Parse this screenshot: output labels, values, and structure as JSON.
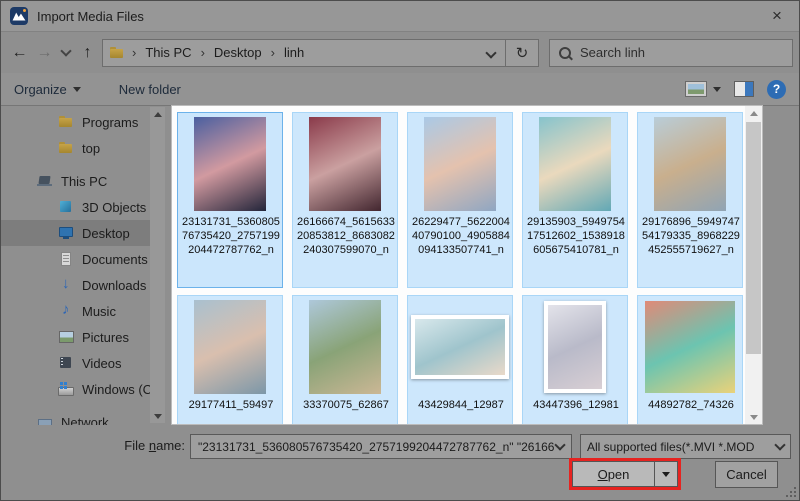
{
  "window": {
    "title": "Import Media Files"
  },
  "icons": {
    "close": "×",
    "back": "←",
    "forward": "→",
    "up": "↑",
    "refresh": "↻",
    "crumb_separator": "›",
    "help": "?"
  },
  "navbar": {
    "breadcrumb": {
      "segments": [
        "This PC",
        "Desktop",
        "linh"
      ]
    },
    "search": {
      "placeholder": "Search linh"
    }
  },
  "toolbar": {
    "organize_label": "Organize",
    "new_folder_label": "New folder"
  },
  "sidebar": {
    "items": [
      {
        "label": "Programs",
        "icon": "folder",
        "indent": 2
      },
      {
        "label": "top",
        "icon": "folder",
        "indent": 2
      },
      {
        "label": "This PC",
        "icon": "computer",
        "indent": 1,
        "group": true
      },
      {
        "label": "3D Objects",
        "icon": "cube",
        "indent": 2
      },
      {
        "label": "Desktop",
        "icon": "monitor",
        "indent": 2,
        "selected": true
      },
      {
        "label": "Documents",
        "icon": "document",
        "indent": 2
      },
      {
        "label": "Downloads",
        "icon": "download",
        "indent": 2
      },
      {
        "label": "Music",
        "icon": "music",
        "indent": 2
      },
      {
        "label": "Pictures",
        "icon": "picture",
        "indent": 2
      },
      {
        "label": "Videos",
        "icon": "film",
        "indent": 2
      },
      {
        "label": "Windows (C:)",
        "icon": "drive",
        "indent": 2
      },
      {
        "label": "Network",
        "icon": "network",
        "indent": 1,
        "group": true
      }
    ]
  },
  "files": [
    {
      "name": "23131731_536080576735420_2757199204472787762_n",
      "desc": "selfie of woman at night club with pink and blue lights",
      "orientation": "portrait",
      "framed": false,
      "focused": true,
      "colors": [
        "#4a5fa0",
        "#d29aa0",
        "#23253a"
      ]
    },
    {
      "name": "26166674_561563320853812_8683082240307599070_n",
      "desc": "woman in gray beanie beside dark red flowers",
      "orientation": "portrait",
      "framed": false,
      "focused": false,
      "colors": [
        "#8a3a4a",
        "#caa0a0",
        "#42262f"
      ]
    },
    {
      "name": "26229477_562200440790100_4905884094133507741_n",
      "desc": "woman in knit beanie against light sky",
      "orientation": "portrait",
      "framed": false,
      "focused": false,
      "colors": [
        "#aac9e6",
        "#e4c2ae",
        "#8fa6c2"
      ]
    },
    {
      "name": "29135903_594975417512602_1538918605675410781_n",
      "desc": "beach scene with round basket boat",
      "orientation": "portrait",
      "framed": false,
      "focused": false,
      "colors": [
        "#86c3cc",
        "#ead9bd",
        "#62a8b5"
      ]
    },
    {
      "name": "29176896_594974754179335_8968229452555719627_n",
      "desc": "woman standing near tan rocks under cloudy sky",
      "orientation": "portrait",
      "framed": false,
      "focused": false,
      "colors": [
        "#b9cdd8",
        "#c9af8d",
        "#90a4b4"
      ]
    },
    {
      "name": "29177411_59497",
      "desc": "woman covering one eye with her hand",
      "orientation": "portrait",
      "framed": false,
      "focused": false,
      "colors": [
        "#a9c0cf",
        "#d9bfae",
        "#7c97a8"
      ]
    },
    {
      "name": "33370075_62867",
      "desc": "woman sitting on rocks with arm raised",
      "orientation": "portrait",
      "framed": false,
      "focused": false,
      "colors": [
        "#aec8da",
        "#89a377",
        "#cbb795"
      ]
    },
    {
      "name": "43429844_12987",
      "desc": "bright seaside photo of woman sitting on wall",
      "orientation": "landscape",
      "framed": true,
      "focused": false,
      "colors": [
        "#d8e8ec",
        "#9fc4cc",
        "#e9d9c9"
      ]
    },
    {
      "name": "43447396_12981",
      "desc": "woman in light coat standing outdoors",
      "orientation": "portrait",
      "framed": true,
      "focused": false,
      "colors": [
        "#e3e3ea",
        "#b9bac9",
        "#d8cfd4"
      ]
    },
    {
      "name": "44892782_74326",
      "desc": "colorful carnival swing ride",
      "orientation": "square",
      "framed": false,
      "focused": false,
      "colors": [
        "#e08a78",
        "#6cc4b0",
        "#ead27a"
      ]
    }
  ],
  "footer": {
    "file_name_label": {
      "pre": "File ",
      "accel": "n",
      "post": "ame:"
    },
    "file_name_value": "\"23131731_536080576735420_2757199204472787762_n\" \"26166",
    "file_type_value": "All supported files(*.MVI *.MOD",
    "open_button": {
      "accel": "O",
      "post": "pen"
    },
    "cancel_label": "Cancel"
  }
}
